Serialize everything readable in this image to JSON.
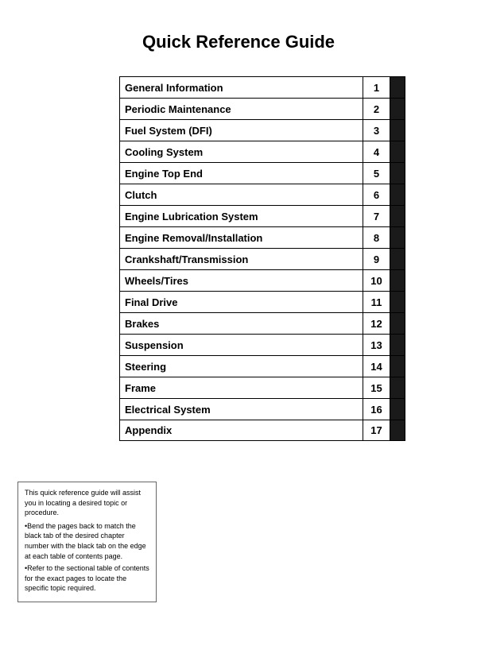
{
  "title": "Quick Reference Guide",
  "toc": {
    "items": [
      {
        "label": "General Information",
        "number": "1"
      },
      {
        "label": "Periodic Maintenance",
        "number": "2"
      },
      {
        "label": "Fuel System (DFI)",
        "number": "3"
      },
      {
        "label": "Cooling System",
        "number": "4"
      },
      {
        "label": "Engine Top End",
        "number": "5"
      },
      {
        "label": "Clutch",
        "number": "6"
      },
      {
        "label": "Engine Lubrication System",
        "number": "7"
      },
      {
        "label": "Engine Removal/Installation",
        "number": "8"
      },
      {
        "label": "Crankshaft/Transmission",
        "number": "9"
      },
      {
        "label": "Wheels/Tires",
        "number": "10"
      },
      {
        "label": "Final Drive",
        "number": "11"
      },
      {
        "label": "Brakes",
        "number": "12"
      },
      {
        "label": "Suspension",
        "number": "13"
      },
      {
        "label": "Steering",
        "number": "14"
      },
      {
        "label": "Frame",
        "number": "15"
      },
      {
        "label": "Electrical System",
        "number": "16"
      },
      {
        "label": "Appendix",
        "number": "17"
      }
    ]
  },
  "note": {
    "line1": "This quick reference guide will assist you in locating a desired topic or procedure.",
    "bullet1": "•Bend the pages back to match the black tab of the desired chapter number with the black tab on the edge at each table of contents page.",
    "bullet2": "•Refer to the sectional table of contents for the exact pages to locate the specific topic required."
  }
}
